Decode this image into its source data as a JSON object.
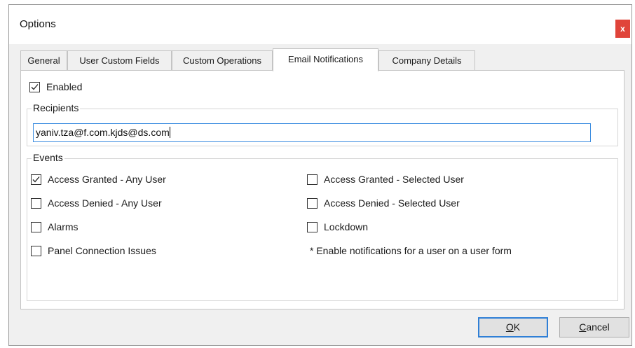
{
  "window": {
    "title": "Options",
    "close_label": "x"
  },
  "tabs": [
    {
      "label": "General",
      "active": false
    },
    {
      "label": "User Custom Fields",
      "active": false
    },
    {
      "label": "Custom Operations",
      "active": false
    },
    {
      "label": "Email Notifications",
      "active": true
    },
    {
      "label": "Company Details",
      "active": false
    }
  ],
  "email": {
    "enabled_label": "Enabled",
    "enabled_checked": true,
    "recipients": {
      "title": "Recipients",
      "value": "yaniv.tza@f.com.kjds@ds.com"
    },
    "events": {
      "title": "Events",
      "left": [
        {
          "label": "Access Granted - Any User",
          "checked": true
        },
        {
          "label": "Access Denied - Any User",
          "checked": false
        },
        {
          "label": "Alarms",
          "checked": false
        },
        {
          "label": "Panel Connection Issues",
          "checked": false
        }
      ],
      "right": [
        {
          "label": "Access Granted - Selected User",
          "checked": false
        },
        {
          "label": "Access Denied - Selected User",
          "checked": false
        },
        {
          "label": "Lockdown",
          "checked": false
        }
      ],
      "note": "* Enable notifications for a user on a user form"
    }
  },
  "buttons": {
    "ok_mnemonic": "O",
    "ok_rest": "K",
    "cancel_mnemonic": "C",
    "cancel_rest": "ancel"
  },
  "colors": {
    "close_bg": "#e0443a",
    "focus_border": "#3c8de0",
    "default_button_border": "#2f7fd6"
  }
}
